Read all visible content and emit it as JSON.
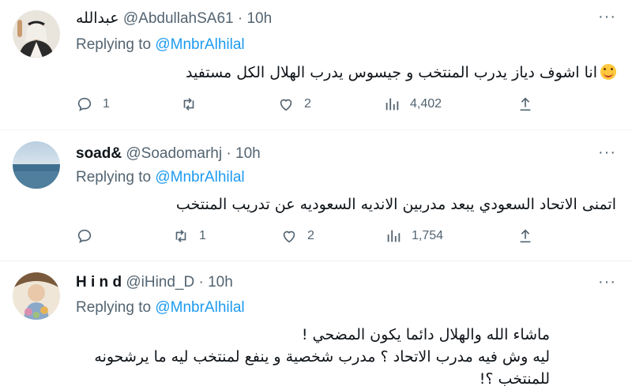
{
  "tweets": [
    {
      "name": "عبدالله",
      "handle": "@AbdullahSA61",
      "dot": "·",
      "time": "10h",
      "replying": "Replying to",
      "mention": "@MnbrAlhilal",
      "body_lines": [
        "انا اشوف دياز يدرب المنتخب و جيسوس يدرب الهلال الكل مستفيد"
      ],
      "emoji": "smiling-face-emoji",
      "replies": "1",
      "retweets": "",
      "likes": "2",
      "views": "4,402"
    },
    {
      "name": "soad&",
      "handle": "@Soadomarhj",
      "dot": "·",
      "time": "10h",
      "replying": "Replying to",
      "mention": "@MnbrAlhilal",
      "body_lines": [
        "اتمنى الاتحاد السعودي يبعد مدربين الانديه السعوديه عن تدريب المنتخب"
      ],
      "replies": "",
      "retweets": "1",
      "likes": "2",
      "views": "1,754"
    },
    {
      "name": "H i n d",
      "handle": "@iHind_D",
      "dot": "·",
      "time": "10h",
      "replying": "Replying to",
      "mention": "@MnbrAlhilal",
      "body_lines": [
        "ماشاء الله والهلال دائما يكون المضحي !",
        "ليه وش فيه مدرب الاتحاد ؟ مدرب شخصية و ينفع لمنتخب ليه ما يرشحونه للمنتخب ؟!"
      ]
    }
  ],
  "more_label": "···",
  "colors": {
    "accent": "#1d9bf0",
    "muted": "#536471",
    "text": "#0f1419",
    "divider": "#eff3f4"
  }
}
